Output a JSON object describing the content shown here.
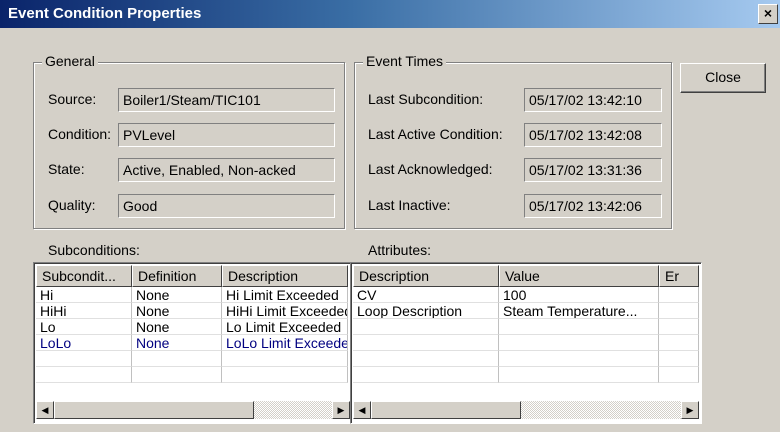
{
  "window": {
    "title": "Event Condition Properties",
    "close_glyph": "×"
  },
  "general": {
    "legend": "General",
    "fields": [
      {
        "label": "Source:",
        "value": "Boiler1/Steam/TIC101"
      },
      {
        "label": "Condition:",
        "value": "PVLevel"
      },
      {
        "label": "State:",
        "value": "Active, Enabled, Non-acked"
      },
      {
        "label": "Quality:",
        "value": "Good"
      }
    ]
  },
  "event_times": {
    "legend": "Event Times",
    "fields": [
      {
        "label": "Last Subcondition:",
        "value": "05/17/02 13:42:10"
      },
      {
        "label": "Last Active Condition:",
        "value": "05/17/02 13:42:08"
      },
      {
        "label": "Last Acknowledged:",
        "value": "05/17/02 13:31:36"
      },
      {
        "label": "Last Inactive:",
        "value": "05/17/02 13:42:06"
      }
    ]
  },
  "close_button": "Close",
  "subconditions": {
    "label": "Subconditions:",
    "columns": [
      "Subcondit...",
      "Definition",
      "Description"
    ],
    "rows": [
      [
        "Hi",
        "None",
        "Hi Limit Exceeded"
      ],
      [
        "HiHi",
        "None",
        "HiHi Limit Exceeded"
      ],
      [
        "Lo",
        "None",
        "Lo Limit Exceeded"
      ],
      [
        "LoLo",
        "None",
        "LoLo Limit Exceeded"
      ]
    ],
    "selected_row": 3
  },
  "attributes": {
    "label": "Attributes:",
    "columns": [
      "Description",
      "Value",
      "Er"
    ],
    "rows": [
      [
        "CV",
        "100",
        ""
      ],
      [
        "Loop Description",
        "Steam Temperature...",
        ""
      ]
    ]
  },
  "icons": {
    "scroll_left": "◀",
    "scroll_right": "▶"
  }
}
